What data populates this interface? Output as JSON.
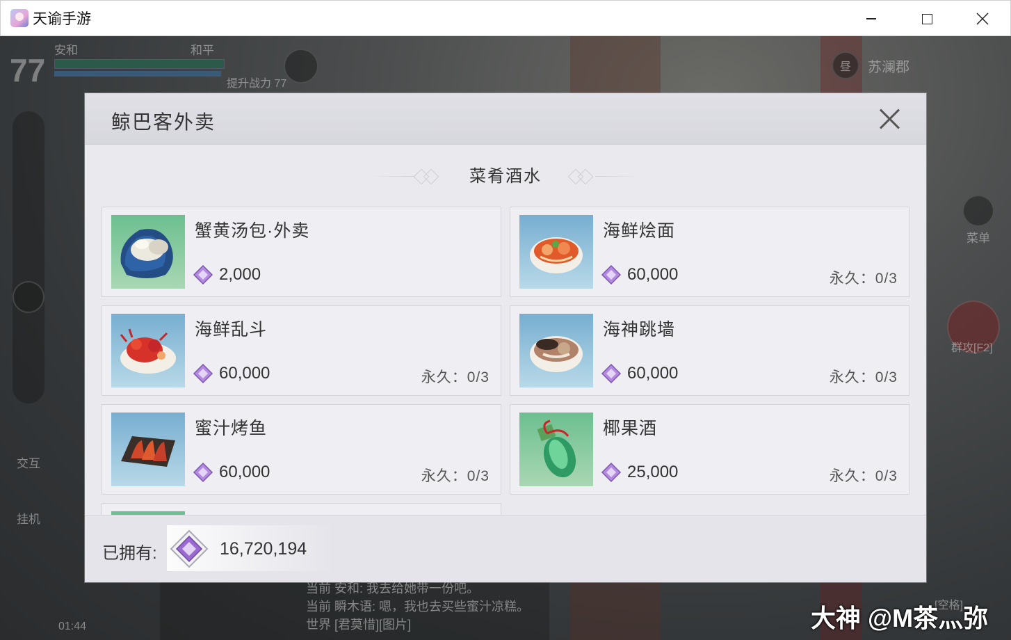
{
  "window": {
    "title": "天谕手游"
  },
  "hud": {
    "level": "77",
    "name_left": "安和",
    "mode": "和平",
    "power_tip": "提升战力 77",
    "location": "苏澜郡",
    "time_badge": "昼",
    "menu_label": "菜单",
    "skill_label": "群攻[F2]",
    "interact_label": "交互",
    "auto_label": "挂机",
    "clock": "01:44",
    "space_label": "[空格]",
    "chat": [
      {
        "channel": "当前",
        "text": "安和: 我去给她带一份吧。"
      },
      {
        "channel": "当前",
        "text": "瞬木语: 嗯，我也去买些蜜汁凉糕。"
      },
      {
        "channel": "世界",
        "text": "[君莫惜][图片]"
      }
    ]
  },
  "modal": {
    "title": "鲸巴客外卖",
    "section_title": "菜肴酒水",
    "items": [
      {
        "name": "蟹黄汤包·外卖",
        "price": "2,000",
        "limit": "",
        "icon": "soup-dumpling-icon",
        "bg": "green"
      },
      {
        "name": "海鲜烩面",
        "price": "60,000",
        "limit": "永久：0/3",
        "icon": "seafood-noodle-icon",
        "bg": "blue"
      },
      {
        "name": "海鲜乱斗",
        "price": "60,000",
        "limit": "永久：0/3",
        "icon": "seafood-platter-icon",
        "bg": "blue"
      },
      {
        "name": "海神跳墙",
        "price": "60,000",
        "limit": "永久：0/3",
        "icon": "seafood-soup-icon",
        "bg": "blue"
      },
      {
        "name": "蜜汁烤鱼",
        "price": "60,000",
        "limit": "永久：0/3",
        "icon": "grilled-fish-icon",
        "bg": "blue"
      },
      {
        "name": "椰果酒",
        "price": "25,000",
        "limit": "永久：0/3",
        "icon": "coconut-wine-icon",
        "bg": "green"
      }
    ],
    "owned_label": "已拥有:",
    "owned_value": "16,720,194"
  },
  "watermark": "大神 @M茶灬弥",
  "colors": {
    "currency": "#9a6ad0",
    "modal_bg": "#e9e9ee"
  }
}
